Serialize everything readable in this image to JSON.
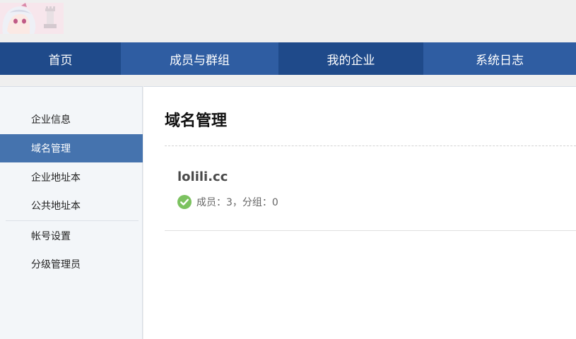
{
  "header": {
    "logo_icon": "anime-avatar-logo"
  },
  "nav": {
    "items": [
      {
        "label": "首页"
      },
      {
        "label": "成员与群组"
      },
      {
        "label": "我的企业"
      },
      {
        "label": "系统日志"
      }
    ]
  },
  "sidebar": {
    "items": [
      {
        "label": "企业信息"
      },
      {
        "label": "域名管理"
      },
      {
        "label": "企业地址本"
      },
      {
        "label": "公共地址本"
      },
      {
        "label": "帐号设置"
      },
      {
        "label": "分级管理员"
      }
    ],
    "active_index": 1
  },
  "main": {
    "title": "域名管理",
    "domains": [
      {
        "name": "lolili.cc",
        "stats": "成员：3，分组：0",
        "status_icon": "check-circle-icon",
        "status_color": "#7cc260"
      }
    ]
  },
  "colors": {
    "nav_bg": "#2f5da2",
    "nav_active_bg": "#1f4a8a",
    "sidebar_active_bg": "#4573ae"
  }
}
